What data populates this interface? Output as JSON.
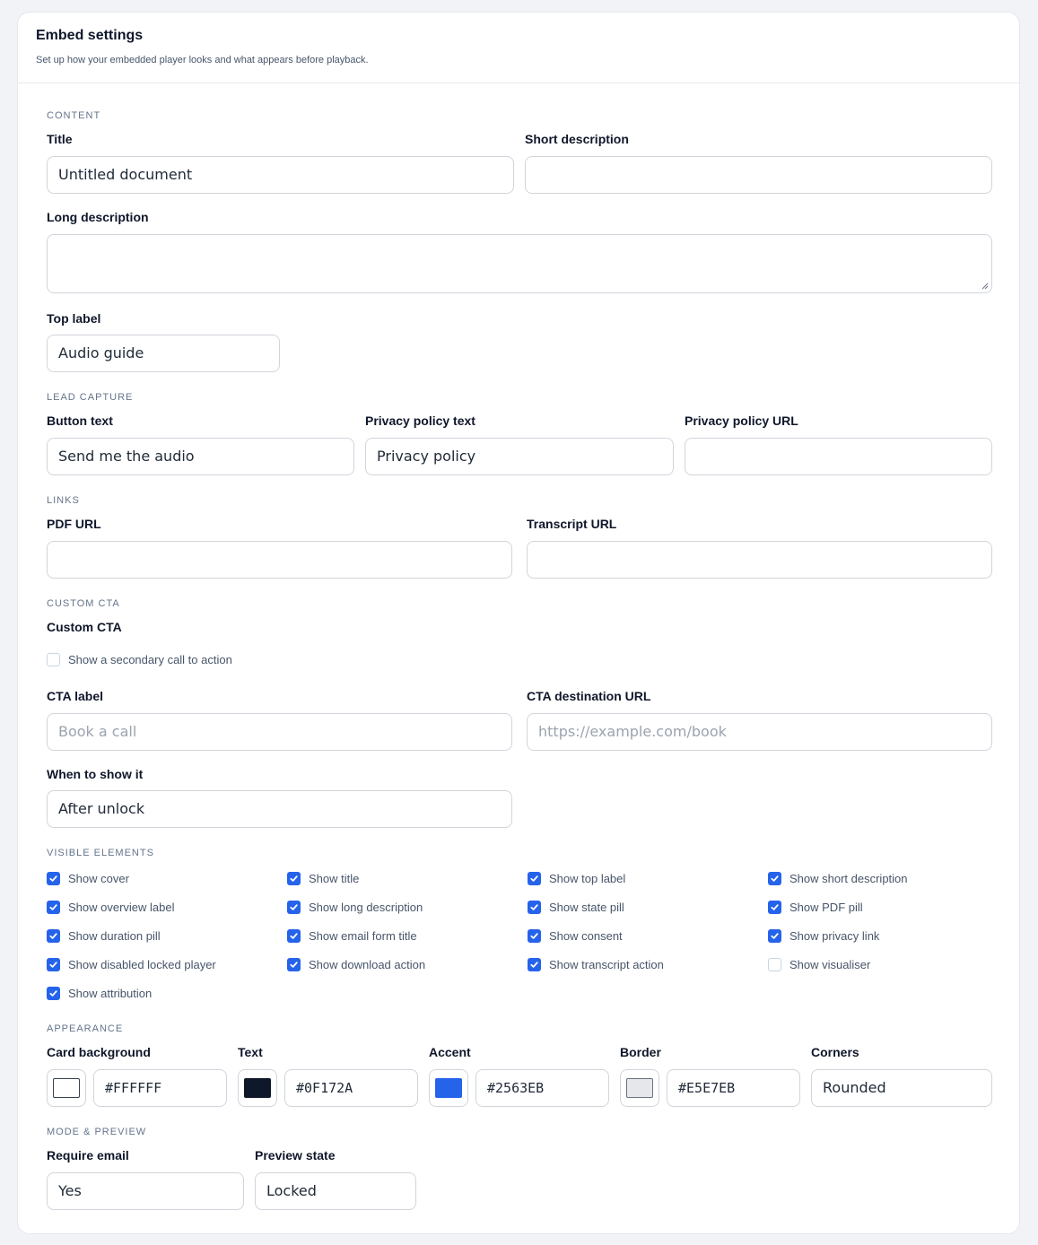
{
  "header": {
    "title": "Embed settings",
    "subtitle": "Set up how your embedded player looks and what appears before playback."
  },
  "content": {
    "section": "CONTENT",
    "title_label": "Title",
    "title_value": "Untitled document",
    "short_desc_label": "Short description",
    "short_desc_value": "",
    "long_desc_label": "Long description",
    "long_desc_value": "",
    "top_label_label": "Top label",
    "top_label_value": "Audio guide"
  },
  "lead_capture": {
    "section": "LEAD CAPTURE",
    "button_text_label": "Button text",
    "button_text_value": "Send me the audio",
    "privacy_text_label": "Privacy policy text",
    "privacy_text_value": "Privacy policy",
    "privacy_url_label": "Privacy policy URL",
    "privacy_url_value": ""
  },
  "links": {
    "section": "LINKS",
    "pdf_url_label": "PDF URL",
    "pdf_url_value": "",
    "transcript_url_label": "Transcript URL",
    "transcript_url_value": ""
  },
  "custom_cta": {
    "section": "CUSTOM CTA",
    "heading": "Custom CTA",
    "secondary_checkbox_label": "Show a secondary call to action",
    "secondary_checked": false,
    "cta_label_label": "CTA label",
    "cta_label_placeholder": "Book a call",
    "cta_url_label": "CTA destination URL",
    "cta_url_placeholder": "https://example.com/book",
    "when_label": "When to show it",
    "when_value": "After unlock"
  },
  "visible_elements": {
    "section": "VISIBLE ELEMENTS",
    "items": [
      {
        "label": "Show cover",
        "checked": true
      },
      {
        "label": "Show title",
        "checked": true
      },
      {
        "label": "Show top label",
        "checked": true
      },
      {
        "label": "Show short description",
        "checked": true
      },
      {
        "label": "Show overview label",
        "checked": true
      },
      {
        "label": "Show long description",
        "checked": true
      },
      {
        "label": "Show state pill",
        "checked": true
      },
      {
        "label": "Show PDF pill",
        "checked": true
      },
      {
        "label": "Show duration pill",
        "checked": true
      },
      {
        "label": "Show email form title",
        "checked": true
      },
      {
        "label": "Show consent",
        "checked": true
      },
      {
        "label": "Show privacy link",
        "checked": true
      },
      {
        "label": "Show disabled locked player",
        "checked": true
      },
      {
        "label": "Show download action",
        "checked": true
      },
      {
        "label": "Show transcript action",
        "checked": true
      },
      {
        "label": "Show visualiser",
        "checked": false
      },
      {
        "label": "Show attribution",
        "checked": true
      }
    ]
  },
  "appearance": {
    "section": "APPEARANCE",
    "card_bg_label": "Card background",
    "card_bg_value": "#FFFFFF",
    "text_label": "Text",
    "text_value": "#0F172A",
    "accent_label": "Accent",
    "accent_value": "#2563EB",
    "border_label": "Border",
    "border_value": "#E5E7EB",
    "corners_label": "Corners",
    "corners_value": "Rounded"
  },
  "mode_preview": {
    "section": "MODE & PREVIEW",
    "require_email_label": "Require email",
    "require_email_value": "Yes",
    "preview_state_label": "Preview state",
    "preview_state_value": "Locked"
  },
  "colors": {
    "checkbox_on": "#2563EB",
    "page_bg": "#F1F3F6",
    "card_bg": "#FFFFFF"
  }
}
